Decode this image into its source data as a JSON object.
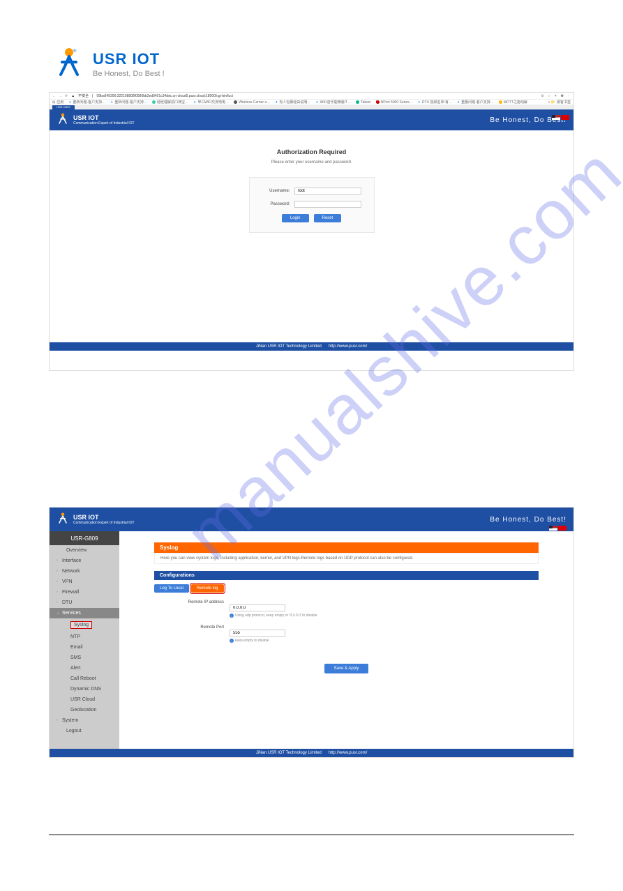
{
  "doc_logo": {
    "name": "USR IOT",
    "tagline": "Be Honest, Do Best !"
  },
  "browser": {
    "url": "09ba649306:322108808f0990bb2ed0401c34ddc.cn-cloud0.pusr.cloud:18000/cgi-bin/luci",
    "security": "不安全",
    "bookmarks": [
      "应用",
      "重新问题-客户支持…",
      "重新问题-客户支持…",
      "经经理解前口神宝…",
      "甲口WiFi交流电电…",
      "Wireless Carrier a…",
      "有人包裹经由说明…",
      "WiFi音乐能精装IT…",
      "Tabsrc",
      "NPort 5000 Series…",
      "DTU 视频名单:有…",
      "重量问题-客户支持…",
      "MOTT之能动解"
    ],
    "bookmark_right": "顾客书签",
    "tab": "USR-G809"
  },
  "app": {
    "name": "USR IOT",
    "subtitle": "Communication Expert of Industrial IOT",
    "slogan": "Be Honest, Do Best!"
  },
  "auth": {
    "title": "Authorization Required",
    "subtitle": "Please enter your username and password.",
    "username_label": "Username:",
    "username_value": "root",
    "password_label": "Password:",
    "password_value": "",
    "login": "Login",
    "reset": "Reset"
  },
  "footer": {
    "company": "JiNan USR IOT Technology Limited",
    "url": "http://www.pusr.com/"
  },
  "watermark": "manualshive.com",
  "syslog": {
    "model": "USR-G809",
    "sidebar": {
      "overview": "Overview",
      "interface": "Interface",
      "network": "Network",
      "vpn": "VPN",
      "firewall": "Firewall",
      "dtu": "DTU",
      "services": "Services",
      "subs": {
        "syslog": "Syslog",
        "ntp": "NTP",
        "email": "Email",
        "sms": "SMS",
        "alert": "Alert",
        "call_reboot": "Call Reboot",
        "dynamic_dns": "Dynamic DNS",
        "usr_cloud": "USR Cloud",
        "geolocation": "Geolocation"
      },
      "system": "System",
      "logout": "Logout"
    },
    "panel_title": "Syslog",
    "panel_desc": "Here you can view system logs, including application, kernel, and VPN logs.Remote logs based on UDP protocol can also be configured.",
    "conf_title": "Configurations",
    "tab1": "Log To Local",
    "tab2": "Remote log",
    "ip_label": "Remote IP address",
    "ip_value": "0.0.0.0",
    "ip_hint": "Using udp protocol, keep empty or '0.0.0.0' to disable",
    "port_label": "Remote Port",
    "port_value": "555",
    "port_hint": "keep empty to disable",
    "save": "Save & Apply"
  }
}
